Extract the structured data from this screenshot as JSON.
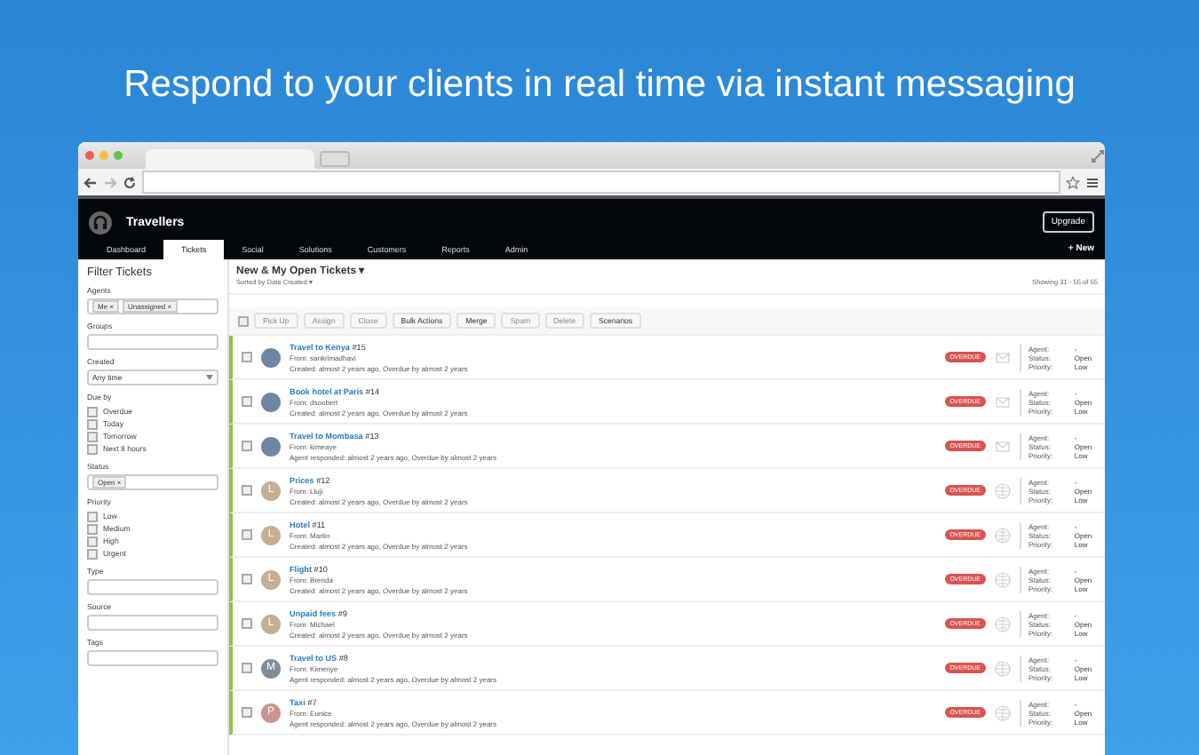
{
  "headline": "Respond to your clients in real time via instant messaging",
  "app": {
    "name": "Travellers",
    "upgrade": "Upgrade",
    "new_button": "+ New"
  },
  "nav": [
    {
      "label": "Dashboard",
      "selected": false
    },
    {
      "label": "Tickets",
      "selected": true
    },
    {
      "label": "Social",
      "selected": false
    },
    {
      "label": "Solutions",
      "selected": false
    },
    {
      "label": "Customers",
      "selected": false
    },
    {
      "label": "Reports",
      "selected": false
    },
    {
      "label": "Admin",
      "selected": false
    }
  ],
  "sidebar": {
    "title": "Filter Tickets",
    "filters": [
      {
        "kind": "tags",
        "label": "Agents",
        "tags": [
          "Me ×",
          "Unassigned ×"
        ]
      },
      {
        "kind": "field",
        "label": "Groups"
      },
      {
        "kind": "select",
        "label": "Created",
        "value": "Any time"
      },
      {
        "kind": "checks",
        "label": "Due by",
        "options": [
          {
            "label": "Overdue",
            "checked": false
          },
          {
            "label": "Today",
            "checked": false
          },
          {
            "label": "Tomorrow",
            "checked": false
          },
          {
            "label": "Next 8 hours",
            "checked": false
          }
        ]
      },
      {
        "kind": "tags",
        "label": "Status",
        "tags": [
          "Open ×"
        ]
      },
      {
        "kind": "checks",
        "label": "Priority",
        "options": [
          {
            "label": "Low",
            "checked": false
          },
          {
            "label": "Medium",
            "checked": false
          },
          {
            "label": "High",
            "checked": false
          },
          {
            "label": "Urgent",
            "checked": false
          }
        ]
      },
      {
        "kind": "field",
        "label": "Type"
      },
      {
        "kind": "field",
        "label": "Source"
      },
      {
        "kind": "field",
        "label": "Tags"
      }
    ]
  },
  "view": {
    "title": "New & My Open Tickets ▾",
    "sort": "Sorted by Date Created ▾",
    "showing": "Showing 31 - 55 of 55",
    "select_all": {
      "checked": false
    }
  },
  "actions": [
    {
      "label": "Pick Up",
      "disabled": true
    },
    {
      "label": "Assign",
      "disabled": true
    },
    {
      "label": "Close",
      "disabled": true
    },
    {
      "label": "Bulk Actions",
      "disabled": false
    },
    {
      "label": "Merge",
      "disabled": false
    },
    {
      "label": "Spam",
      "disabled": true
    },
    {
      "label": "Delete",
      "disabled": true
    },
    {
      "label": "Scenarios",
      "disabled": false
    }
  ],
  "tickets": [
    {
      "checked": false,
      "avatar": {
        "kind": "photo"
      },
      "title": "Travel to Kenya",
      "number": "#15",
      "from": "From: sankrimadhavi",
      "activity": "Created: almost 2 years ago, Overdue by almost 2 years",
      "channel": {
        "kind": "email"
      },
      "badge": "OVERDUE",
      "props": [
        {
          "label": "Agent:",
          "value": "-"
        },
        {
          "label": "Status:",
          "value": "Open"
        },
        {
          "label": "Priority:",
          "value": "Low"
        }
      ]
    },
    {
      "checked": false,
      "avatar": {
        "kind": "photo"
      },
      "title": "Book hotel at Paris",
      "number": "#14",
      "from": "From: dsoobert",
      "activity": "Created: almost 2 years ago, Overdue by almost 2 years",
      "channel": {
        "kind": "email"
      },
      "badge": "OVERDUE",
      "props": [
        {
          "label": "Agent:",
          "value": "-"
        },
        {
          "label": "Status:",
          "value": "Open"
        },
        {
          "label": "Priority:",
          "value": "Low"
        }
      ]
    },
    {
      "checked": false,
      "avatar": {
        "kind": "photo"
      },
      "title": "Travel to Mombasa",
      "number": "#13",
      "from": "From: kimeaye",
      "activity": "Agent responded: almost 2 years ago, Overdue by almost 2 years",
      "channel": {
        "kind": "email"
      },
      "badge": "OVERDUE",
      "props": [
        {
          "label": "Agent:",
          "value": "-"
        },
        {
          "label": "Status:",
          "value": "Open"
        },
        {
          "label": "Priority:",
          "value": "Low"
        }
      ]
    },
    {
      "checked": false,
      "avatar": {
        "kind": "letter",
        "letter": "L",
        "color": "#c5ae94"
      },
      "title": "Prices",
      "number": "#12",
      "from": "From: Lluji",
      "activity": "Created: almost 2 years ago, Overdue by almost 2 years",
      "channel": {
        "kind": "portal"
      },
      "badge": "OVERDUE",
      "props": [
        {
          "label": "Agent:",
          "value": "-"
        },
        {
          "label": "Status:",
          "value": "Open"
        },
        {
          "label": "Priority:",
          "value": "Low"
        }
      ]
    },
    {
      "checked": false,
      "avatar": {
        "kind": "letter",
        "letter": "L",
        "color": "#c5ae94"
      },
      "title": "Hotel",
      "number": "#11",
      "from": "From: Martin",
      "activity": "Created: almost 2 years ago, Overdue by almost 2 years",
      "channel": {
        "kind": "portal"
      },
      "badge": "OVERDUE",
      "props": [
        {
          "label": "Agent:",
          "value": "-"
        },
        {
          "label": "Status:",
          "value": "Open"
        },
        {
          "label": "Priority:",
          "value": "Low"
        }
      ]
    },
    {
      "checked": false,
      "avatar": {
        "kind": "letter",
        "letter": "L",
        "color": "#c5ae94"
      },
      "title": "Flight",
      "number": "#10",
      "from": "From: Brenda",
      "activity": "Created: almost 2 years ago, Overdue by almost 2 years",
      "channel": {
        "kind": "portal"
      },
      "badge": "OVERDUE",
      "props": [
        {
          "label": "Agent:",
          "value": "-"
        },
        {
          "label": "Status:",
          "value": "Open"
        },
        {
          "label": "Priority:",
          "value": "Low"
        }
      ]
    },
    {
      "checked": false,
      "avatar": {
        "kind": "letter",
        "letter": "L",
        "color": "#c5ae94"
      },
      "title": "Unpaid fees",
      "number": "#9",
      "from": "From: Michael",
      "activity": "Created: almost 2 years ago, Overdue by almost 2 years",
      "channel": {
        "kind": "portal"
      },
      "badge": "OVERDUE",
      "props": [
        {
          "label": "Agent:",
          "value": "-"
        },
        {
          "label": "Status:",
          "value": "Open"
        },
        {
          "label": "Priority:",
          "value": "Low"
        }
      ]
    },
    {
      "checked": false,
      "avatar": {
        "kind": "letter",
        "letter": "M",
        "color": "#7d8e99"
      },
      "title": "Travel to US",
      "number": "#8",
      "from": "From: Kimenye",
      "activity": "Agent responded: almost 2 years ago, Overdue by almost 2 years",
      "channel": {
        "kind": "portal"
      },
      "badge": "OVERDUE",
      "props": [
        {
          "label": "Agent:",
          "value": "-"
        },
        {
          "label": "Status:",
          "value": "Open"
        },
        {
          "label": "Priority:",
          "value": "Low"
        }
      ]
    },
    {
      "checked": false,
      "avatar": {
        "kind": "letter",
        "letter": "P",
        "color": "#c9938f"
      },
      "title": "Taxi",
      "number": "#7",
      "from": "From: Eunice",
      "activity": "Agent responded: almost 2 years ago, Overdue by almost 2 years",
      "channel": {
        "kind": "portal"
      },
      "badge": "OVERDUE",
      "props": [
        {
          "label": "Agent:",
          "value": "-"
        },
        {
          "label": "Status:",
          "value": "Open"
        },
        {
          "label": "Priority:",
          "value": "Low"
        }
      ]
    }
  ]
}
